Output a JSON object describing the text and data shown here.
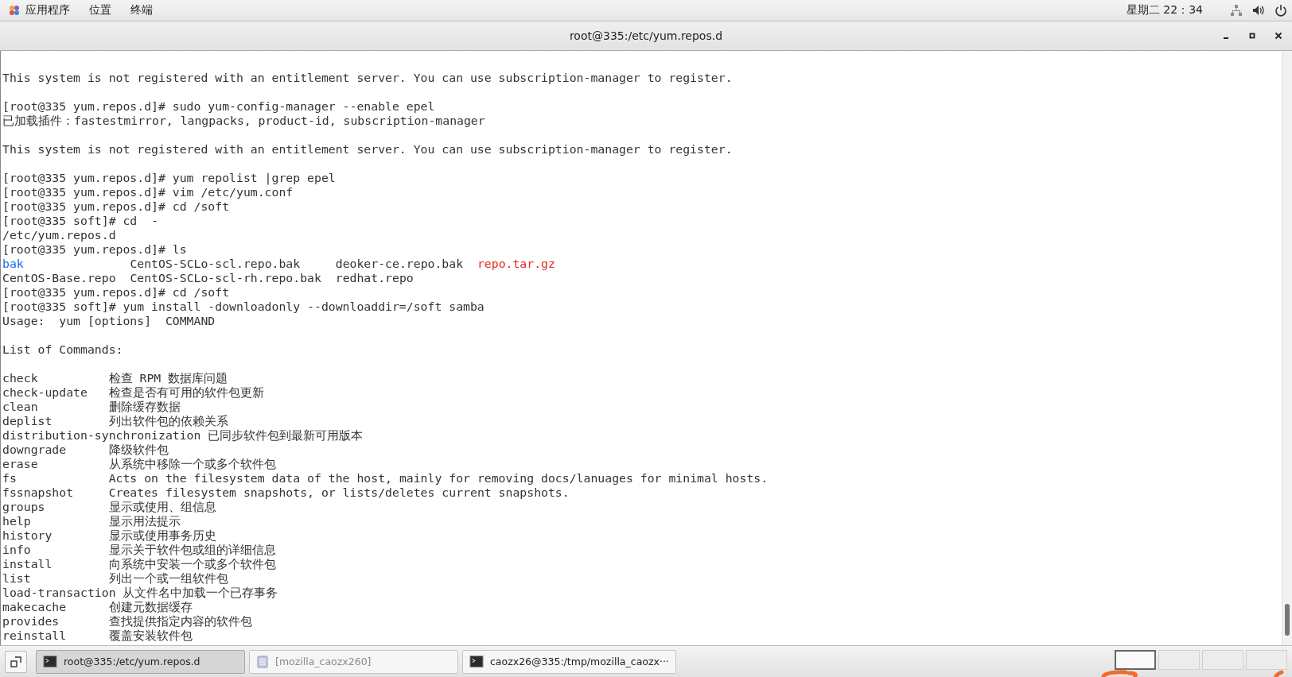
{
  "top_bar": {
    "menus": [
      "应用程序",
      "位置",
      "终端"
    ],
    "clock": "星期二 22：34"
  },
  "window": {
    "title": "root@335:/etc/yum.repos.d"
  },
  "terminal": {
    "lines": [
      {
        "kind": "text",
        "text": "This system is not registered with an entitlement server. You can use subscription-manager to register."
      },
      {
        "kind": "blank"
      },
      {
        "kind": "text",
        "text": "[root@335 yum.repos.d]# sudo yum-config-manager --enable epel"
      },
      {
        "kind": "text",
        "text": "已加载插件：fastestmirror, langpacks, product-id, subscription-manager"
      },
      {
        "kind": "blank"
      },
      {
        "kind": "text",
        "text": "This system is not registered with an entitlement server. You can use subscription-manager to register."
      },
      {
        "kind": "blank"
      },
      {
        "kind": "text",
        "text": "[root@335 yum.repos.d]# yum repolist |grep epel"
      },
      {
        "kind": "text",
        "text": "[root@335 yum.repos.d]# vim /etc/yum.conf"
      },
      {
        "kind": "text",
        "text": "[root@335 yum.repos.d]# cd /soft"
      },
      {
        "kind": "text",
        "text": "[root@335 soft]# cd  -"
      },
      {
        "kind": "text",
        "text": "/etc/yum.repos.d"
      },
      {
        "kind": "text",
        "text": "[root@335 yum.repos.d]# ls"
      },
      {
        "kind": "files",
        "entries": [
          {
            "name": "bak",
            "color": "#1a6ee6"
          },
          {
            "name": "CentOS-SCLo-scl.repo.bak",
            "color": "#333333"
          },
          {
            "name": "deoker-ce.repo.bak",
            "color": "#333333"
          },
          {
            "name": "repo.tar.gz",
            "color": "#e8281e"
          }
        ]
      },
      {
        "kind": "files",
        "entries": [
          {
            "name": "CentOS-Base.repo",
            "color": "#333333"
          },
          {
            "name": "CentOS-SCLo-scl-rh.repo.bak",
            "color": "#333333"
          },
          {
            "name": "redhat.repo",
            "color": "#333333"
          }
        ]
      },
      {
        "kind": "text",
        "text": "[root@335 yum.repos.d]# cd /soft"
      },
      {
        "kind": "text",
        "text": "[root@335 soft]# yum install -downloadonly --downloaddir=/soft samba"
      },
      {
        "kind": "text",
        "text": "Usage:  yum [options]  COMMAND"
      },
      {
        "kind": "blank"
      },
      {
        "kind": "text",
        "text": "List of Commands:"
      },
      {
        "kind": "blank"
      },
      {
        "kind": "command",
        "name": "check",
        "desc": "检查 RPM 数据库问题"
      },
      {
        "kind": "command",
        "name": "check-update",
        "desc": "检查是否有可用的软件包更新"
      },
      {
        "kind": "command",
        "name": "clean",
        "desc": "删除缓存数据"
      },
      {
        "kind": "command",
        "name": "deplist",
        "desc": "列出软件包的依赖关系"
      },
      {
        "kind": "command",
        "name": "distribution-synchronization",
        "desc": "已同步软件包到最新可用版本"
      },
      {
        "kind": "command",
        "name": "downgrade",
        "desc": "降级软件包"
      },
      {
        "kind": "command",
        "name": "erase",
        "desc": "从系统中移除一个或多个软件包"
      },
      {
        "kind": "command",
        "name": "fs",
        "desc": "Acts on the filesystem data of the host, mainly for removing docs/lanuages for minimal hosts."
      },
      {
        "kind": "command",
        "name": "fssnapshot",
        "desc": "Creates filesystem snapshots, or lists/deletes current snapshots."
      },
      {
        "kind": "command",
        "name": "groups",
        "desc": "显示或使用、组信息"
      },
      {
        "kind": "command",
        "name": "help",
        "desc": "显示用法提示"
      },
      {
        "kind": "command",
        "name": "history",
        "desc": "显示或使用事务历史"
      },
      {
        "kind": "command",
        "name": "info",
        "desc": "显示关于软件包或组的详细信息"
      },
      {
        "kind": "command",
        "name": "install",
        "desc": "向系统中安装一个或多个软件包"
      },
      {
        "kind": "command",
        "name": "list",
        "desc": "列出一个或一组软件包"
      },
      {
        "kind": "command",
        "name": "load-transaction",
        "desc": "从文件名中加载一个已存事务"
      },
      {
        "kind": "command",
        "name": "makecache",
        "desc": "创建元数据缓存"
      },
      {
        "kind": "command",
        "name": "provides",
        "desc": "查找提供指定内容的软件包"
      },
      {
        "kind": "command",
        "name": "reinstall",
        "desc": "覆盖安装软件包"
      }
    ]
  },
  "taskbar": {
    "tasks": [
      {
        "label": "root@335:/etc/yum.repos.d",
        "selected": true,
        "minimized": false,
        "kind": "terminal"
      },
      {
        "label": "[mozilla_caozx260]",
        "selected": false,
        "minimized": true,
        "kind": "file"
      },
      {
        "label": "caozx26@335:/tmp/mozilla_caozx···",
        "selected": false,
        "minimized": false,
        "kind": "terminal"
      }
    ],
    "workspaces": [
      {
        "selected": true
      },
      {
        "selected": false
      },
      {
        "selected": false
      },
      {
        "selected": false
      }
    ]
  }
}
